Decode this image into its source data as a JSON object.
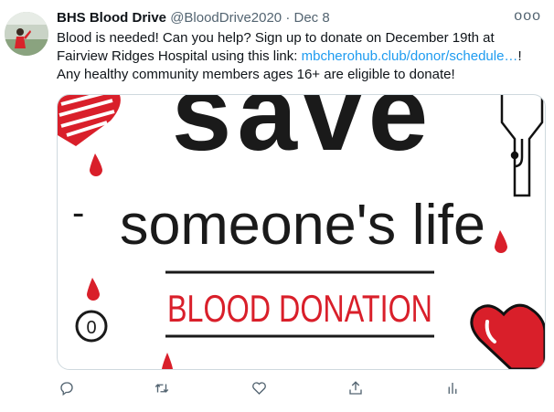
{
  "author": {
    "name": "BHS Blood Drive",
    "handle": "@BloodDrive2020",
    "separator": "·",
    "date": "Dec 8"
  },
  "more_label": "ooo",
  "tweet_text": {
    "line1": "Blood is needed! Can you help? Sign up to donate on December 19th at",
    "line2_before": "Fairview Ridges Hospital using this link: ",
    "line2_link": "mbcherohub.club/donor/schedule…",
    "line2_after": "!",
    "line3": "Any healthy community members ages 16+ are eligible to donate!"
  },
  "image": {
    "headline": "save",
    "subline": "someone's life",
    "banner": "BLOOD DONATION",
    "dash": "-",
    "badge": "0"
  },
  "colors": {
    "link": "#1d9bf0",
    "blood_red": "#d91f2a",
    "muted": "#536471"
  },
  "icons": [
    "reply-icon",
    "retweet-icon",
    "like-icon",
    "share-icon",
    "analytics-icon"
  ]
}
